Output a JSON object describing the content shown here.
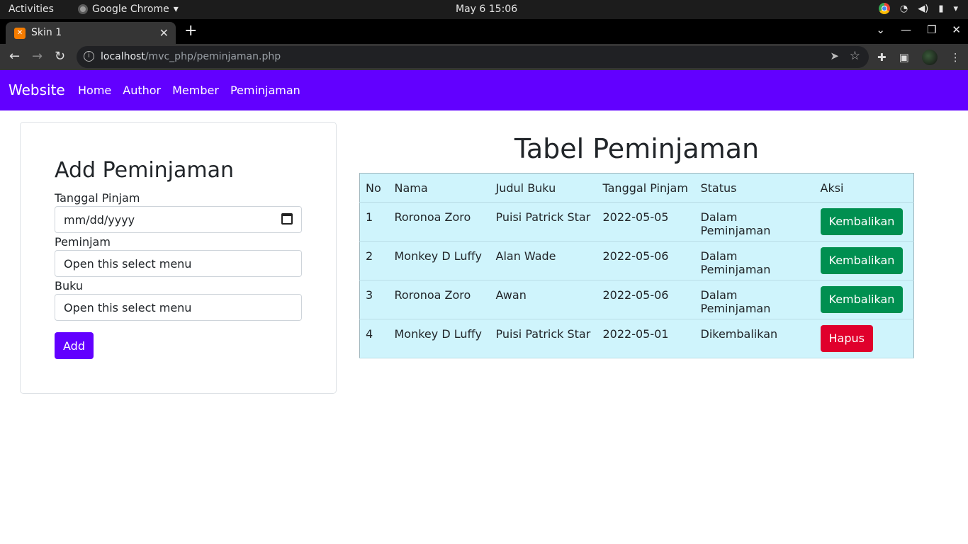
{
  "system_bar": {
    "activities": "Activities",
    "app_name": "Google Chrome",
    "clock": "May 6  15:06"
  },
  "browser": {
    "tab_title": "Skin 1",
    "url_host": "localhost",
    "url_path": "/mvc_php/peminjaman.php"
  },
  "navbar": {
    "brand": "Website",
    "links": [
      "Home",
      "Author",
      "Member",
      "Peminjaman"
    ]
  },
  "form": {
    "title": "Add Peminjaman",
    "date_label": "Tanggal Pinjam",
    "date_placeholder": "mm/dd/yyyy",
    "peminjam_label": "Peminjam",
    "peminjam_value": "Open this select menu",
    "buku_label": "Buku",
    "buku_value": "Open this select menu",
    "submit_label": "Add"
  },
  "table": {
    "title": "Tabel Peminjaman",
    "headers": [
      "No",
      "Nama",
      "Judul Buku",
      "Tanggal Pinjam",
      "Status",
      "Aksi"
    ],
    "rows": [
      {
        "no": "1",
        "nama": "Roronoa Zoro",
        "judul": "Puisi Patrick Star",
        "tanggal": "2022-05-05",
        "status": "Dalam Peminjaman",
        "aksi": "Kembalikan"
      },
      {
        "no": "2",
        "nama": "Monkey D Luffy",
        "judul": "Alan Wade",
        "tanggal": "2022-05-06",
        "status": "Dalam Peminjaman",
        "aksi": "Kembalikan"
      },
      {
        "no": "3",
        "nama": "Roronoa Zoro",
        "judul": "Awan",
        "tanggal": "2022-05-06",
        "status": "Dalam Peminjaman",
        "aksi": "Kembalikan"
      },
      {
        "no": "4",
        "nama": "Monkey D Luffy",
        "judul": "Puisi Patrick Star",
        "tanggal": "2022-05-01",
        "status": "Dikembalikan",
        "aksi": "Hapus"
      }
    ]
  },
  "colors": {
    "brand": "#6200ff",
    "table_bg": "#cff4fc",
    "return_button": "#008f50",
    "delete_button": "#e0002c"
  }
}
